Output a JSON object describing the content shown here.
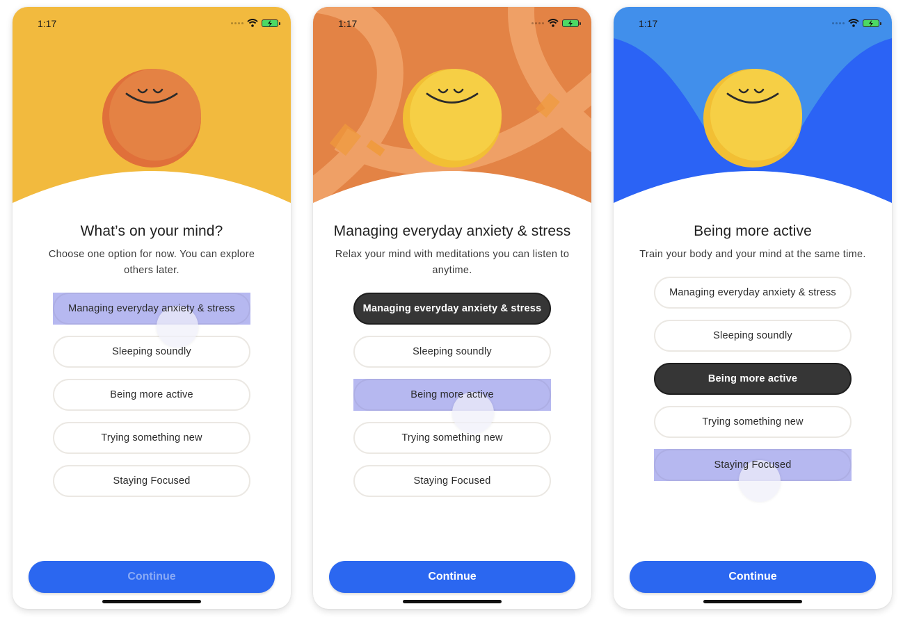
{
  "status_bar": {
    "time": "1:17"
  },
  "colors": {
    "yellow_bg": "#f2ba3e",
    "orange_bg": "#e38345",
    "orange_ring": "#efa066",
    "blue_bg": "#418feb",
    "blue_wave": "#2b63f5",
    "face_orange": "#e48244",
    "face_yellow": "#f6cf45",
    "accent_blue": "#2b67f0",
    "selected_dark": "#363636",
    "tap_highlight": "#7c80e4"
  },
  "screens": [
    {
      "title": "What’s on your mind?",
      "subtitle": "Choose one option for now. You can explore others later.",
      "options": [
        {
          "label": "Managing everyday anxiety & stress",
          "state": "pressed"
        },
        {
          "label": "Sleeping soundly",
          "state": "default"
        },
        {
          "label": "Being more active",
          "state": "default"
        },
        {
          "label": "Trying something new",
          "state": "default"
        },
        {
          "label": "Staying Focused",
          "state": "default"
        }
      ],
      "continue_label": "Continue",
      "continue_enabled": false
    },
    {
      "title": "Managing everyday anxiety & stress",
      "subtitle": "Relax your mind with meditations you can listen to anytime.",
      "options": [
        {
          "label": "Managing everyday anxiety & stress",
          "state": "selected"
        },
        {
          "label": "Sleeping soundly",
          "state": "default"
        },
        {
          "label": "Being more active",
          "state": "pressed"
        },
        {
          "label": "Trying something new",
          "state": "default"
        },
        {
          "label": "Staying Focused",
          "state": "default"
        }
      ],
      "continue_label": "Continue",
      "continue_enabled": true
    },
    {
      "title": "Being more active",
      "subtitle": "Train your body and your mind at the same time.",
      "options": [
        {
          "label": "Managing everyday anxiety & stress",
          "state": "default"
        },
        {
          "label": "Sleeping soundly",
          "state": "default"
        },
        {
          "label": "Being more active",
          "state": "selected"
        },
        {
          "label": "Trying something new",
          "state": "default"
        },
        {
          "label": "Staying Focused",
          "state": "pressed"
        }
      ],
      "continue_label": "Continue",
      "continue_enabled": true
    }
  ]
}
